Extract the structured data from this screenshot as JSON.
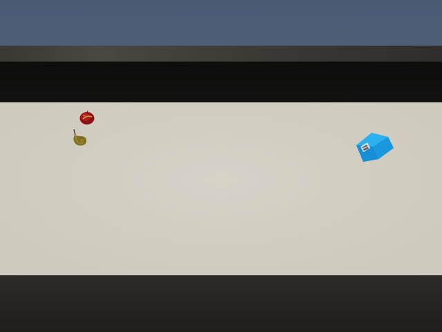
{
  "scene": {
    "colors": {
      "back_wall": "#4d5c76",
      "ledge": "#3d3b37",
      "shadow_band": "#0f0f0e",
      "floor": "#d0ccc0",
      "front_edge": "#262522",
      "apple": "#a0141a",
      "pear": "#8c7d24",
      "cube": "#1a9de3"
    },
    "objects": [
      {
        "name": "apple",
        "icon": "apple-icon"
      },
      {
        "name": "pear",
        "icon": "pear-icon"
      },
      {
        "name": "blue-cube",
        "icon": "cube-icon"
      }
    ]
  }
}
